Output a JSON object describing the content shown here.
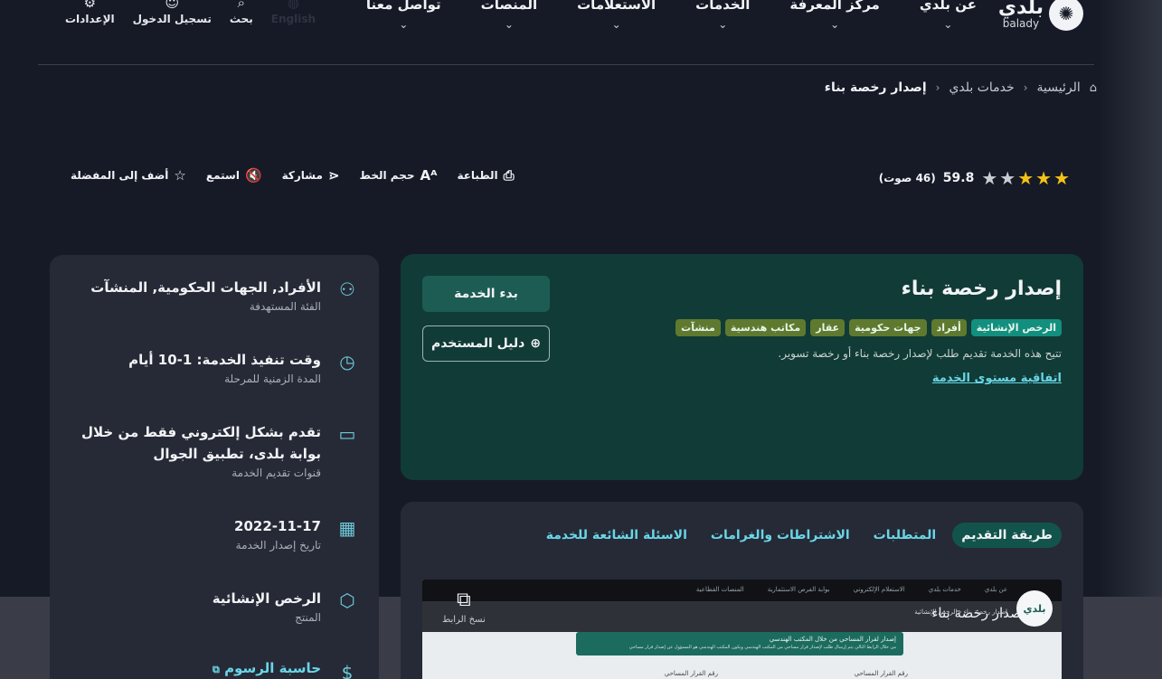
{
  "header": {
    "logo": {
      "ar": "بلدي",
      "en": "balady"
    },
    "nav": [
      "عن بلدي",
      "مركز المعرفة",
      "الخدمات",
      "الاستعلامات",
      "المنصات",
      "تواصل معنا"
    ],
    "tools": {
      "language": "English",
      "search": "بحث",
      "login": "تسجيل الدخول",
      "settings": "الإعدادات"
    }
  },
  "breadcrumb": [
    "الرئيسية",
    "خدمات بلدي",
    "إصدار رخصة بناء"
  ],
  "rating": {
    "score": "59.8",
    "votes": "(46 صوت)",
    "stars_filled": 3,
    "stars_total": 5
  },
  "actions": {
    "favorite": "أضف إلى المفضلة",
    "listen": "استمع",
    "share": "مشاركة",
    "font_size": "حجم الخط",
    "print": "الطباعة"
  },
  "sidebar": [
    {
      "icon": "user-icon",
      "value": "الأفراد, الجهات الحكومية, المنشآت",
      "label": "الفئة المستهدفة"
    },
    {
      "icon": "clock-icon",
      "value": "وقت تنفيذ الخدمة: 1-10 أيام",
      "label": "المدة الزمنية للمرحلة"
    },
    {
      "icon": "monitor-icon",
      "value": "تقدم بشكل إلكتروني فقط من خلال بوابة بلدى، تطبيق الجوال",
      "label": "قنوات تقديم الخدمة"
    },
    {
      "icon": "calendar-icon",
      "value": "2022-11-17",
      "label": "تاريخ إصدار الخدمة"
    },
    {
      "icon": "box-icon",
      "value": "الرخص الإنشائية",
      "label": "المنتج"
    },
    {
      "icon": "dollar-icon",
      "value": "حاسبة الرسوم",
      "label": ""
    }
  ],
  "service": {
    "title": "إصدار رخصة بناء",
    "tags": [
      {
        "label": "الرخص الإنشائية",
        "color": "#128f7f"
      },
      {
        "label": "أفراد",
        "color": "#5f7a2f"
      },
      {
        "label": "جهات حكومية",
        "color": "#5f7a2f"
      },
      {
        "label": "عقار",
        "color": "#5f7a2f"
      },
      {
        "label": "مكاتب هندسية",
        "color": "#5f7a2f"
      },
      {
        "label": "منشآت",
        "color": "#5f7a2f"
      }
    ],
    "description": "تتيح هذه الخدمة تقديم طلب لإصدار رخصة بناء أو رخصة تسوير.",
    "sla_link": "اتفاقية مستوى الخدمة",
    "start_button": "بدء الخدمة",
    "guide_button": "دليل المستخدم"
  },
  "tabs": [
    "طريقة التقديم",
    "المتطلبات",
    "الاشتراطات والغرامات",
    "الاسئلة الشائعة للخدمة"
  ],
  "preview": {
    "nav": [
      "عن بلدي",
      "خدمات بلدي",
      "الاستعلام الإلكتروني",
      "بوابة الفرص الاستثمارية",
      "المنصات القطاعية"
    ],
    "hero_title": "إصدار رخصة بناء",
    "logo_text": "بلدي",
    "crumb": "إصدار رخصة بناء  ‹  الرخص الإنشائية",
    "banner_title": "إصدار لقرار المساحي من خلال المكتب الهندسي",
    "banner_sub": "من خلال الرابط التالي يتم إرسال طلب لإصدار قرار مساحي من المكتب الهندسي ويكون المكتب الهندسي هو المسؤول عن إصدار قرار مساحي",
    "row_label": "رقم القرار المساحي",
    "copy_link": "نسخ الرابط"
  },
  "colors": {
    "background": "#161a26",
    "card": "#262a36",
    "service_card": "#113b36",
    "accent": "#69d6e8",
    "star": "#f3c316"
  }
}
